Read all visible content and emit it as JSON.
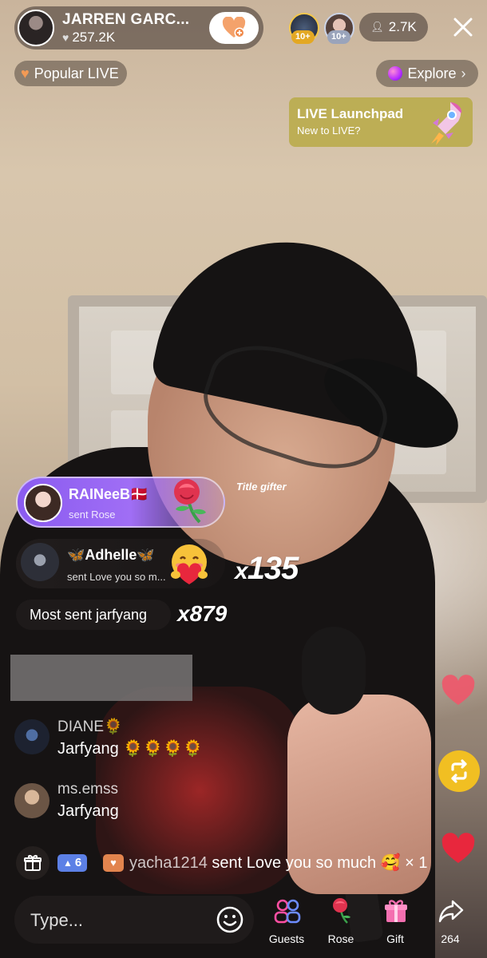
{
  "host": {
    "name": "JARREN GARC...",
    "likes": "257.2K"
  },
  "viewers": {
    "badge_1": "10+",
    "badge_2": "10+",
    "count": "2.7K"
  },
  "labels": {
    "popular": "Popular LIVE",
    "explore": "Explore"
  },
  "launchpad": {
    "title": "LIVE Launchpad",
    "subtitle": "New to LIVE?"
  },
  "gifts": {
    "banner_1": {
      "name": "RAINeeB🇩🇰",
      "action": "sent Rose"
    },
    "title_gifter": "Title gifter",
    "banner_2": {
      "name": "🦋Adhelle🦋",
      "action": "sent Love you so m..."
    },
    "combo_1": "135",
    "most_sent": "Most sent jarfyang",
    "combo_2": "x879"
  },
  "comments": [
    {
      "user": "DIANE🌻",
      "message": "Jarfyang 🌻🌻🌻🌻"
    },
    {
      "user": "ms.emss",
      "message": "Jarfyang"
    }
  ],
  "ticker": {
    "level": "6",
    "username": "yacha1214",
    "text": " sent Love you so much 🥰 × 1"
  },
  "bottom_bar": {
    "placeholder": "Type...",
    "guests": "Guests",
    "rose": "Rose",
    "gift": "Gift",
    "share_count": "264"
  },
  "colors": {
    "accent_pink": "#fe2c55",
    "repost_yellow": "#f1bf22",
    "gift_purple": "#8a5bf0",
    "level_blue": "#5c80e6"
  }
}
